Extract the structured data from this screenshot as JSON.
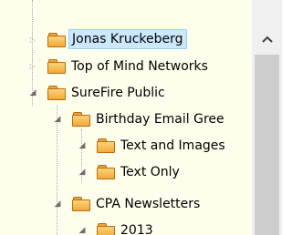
{
  "tree": {
    "items": [
      {
        "label": "Jonas Kruckeberg",
        "state": "collapsed",
        "selected": true
      },
      {
        "label": "Top of Mind Networks",
        "state": "collapsed"
      },
      {
        "label": "SureFire Public",
        "state": "expanded"
      },
      {
        "label": "Birthday Email Gree",
        "state": "expanded"
      },
      {
        "label": "Text and Images",
        "state": "expanded"
      },
      {
        "label": "Text Only",
        "state": "expanded"
      },
      {
        "label": "CPA Newsletters",
        "state": "expanded"
      },
      {
        "label": "2013",
        "state": "expanded"
      }
    ]
  },
  "icons": {
    "folder": "folder-icon",
    "collapsed_toggle": "collapsed-triangle-icon",
    "expanded_toggle": "expanded-triangle-icon",
    "scroll_up": "chevron-up-icon"
  },
  "colors": {
    "pane_background": "#ffffee",
    "selection_fill": "#cce8ff",
    "selection_border": "#99d1ff",
    "folder": "#f4a93a",
    "scrollbar_track": "#f0f0f0",
    "scrollbar_thumb": "#cdcdcd"
  }
}
